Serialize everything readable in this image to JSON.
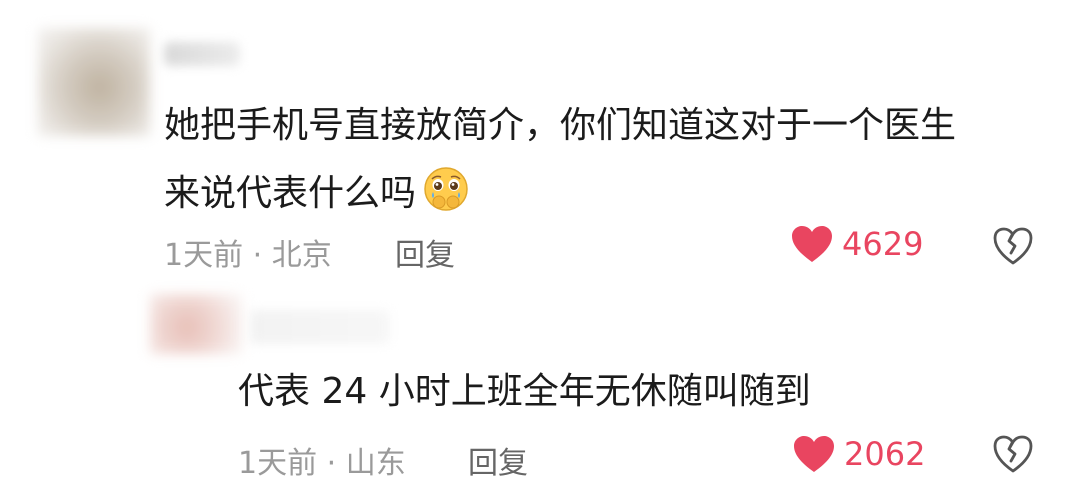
{
  "comments": [
    {
      "content_line1": "她把手机号直接放简介，你们知道这对于一个医生",
      "content_line2": "来说代表什么吗",
      "emoji": "pleading-crying-face",
      "meta": "1天前 · 北京",
      "reply_label": "回复",
      "likes": "4629"
    },
    {
      "content": "代表 24 小时上班全年无休随叫随到",
      "meta": "1天前 · 山东",
      "reply_label": "回复",
      "likes": "2062"
    }
  ],
  "colors": {
    "like": "#e94560",
    "meta": "#9a9a9a",
    "text": "#1b1b1b"
  },
  "icons": [
    "heart-icon",
    "broken-heart-icon"
  ]
}
